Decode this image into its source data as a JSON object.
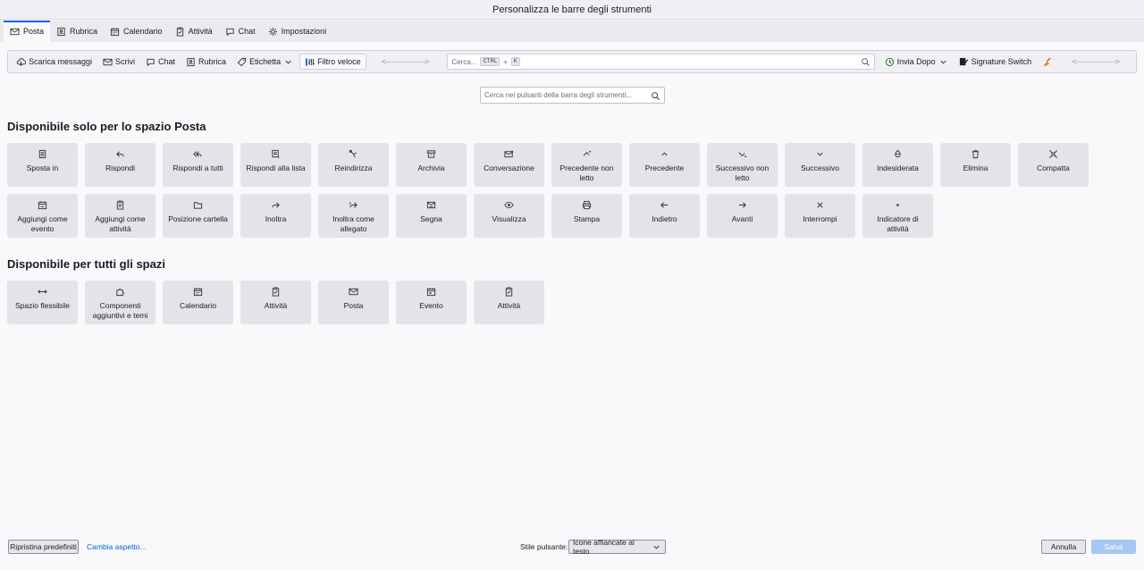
{
  "window": {
    "title": "Personalizza le barre degli strumenti"
  },
  "tabs": [
    {
      "label": "Posta",
      "icon": "mail-icon",
      "active": true
    },
    {
      "label": "Rubrica",
      "icon": "address-book-icon",
      "active": false
    },
    {
      "label": "Calendario",
      "icon": "calendar-icon",
      "active": false
    },
    {
      "label": "Attività",
      "icon": "tasks-icon",
      "active": false
    },
    {
      "label": "Chat",
      "icon": "chat-icon",
      "active": false
    },
    {
      "label": "Impostazioni",
      "icon": "gear-icon",
      "active": false
    }
  ],
  "toolbar": {
    "get_messages": "Scarica messaggi",
    "write": "Scrivi",
    "chat": "Chat",
    "address_book": "Rubrica",
    "tag": "Etichetta",
    "quick_filter": "Filtro veloce",
    "flexible_space": "<- - - - - - - - - - - - ->",
    "search_placeholder": "Cerca...",
    "search_key1": "CTRL",
    "search_plus": "+",
    "search_key2": "K",
    "send_later": "Invia Dopo",
    "signature_switch": "Signature Switch",
    "flexible_space_2": "<- - - - - - - - - - - - ->"
  },
  "palette_search": {
    "placeholder": "Cerca nei pulsanti della barra degli strumenti..."
  },
  "sections": {
    "mail_only": "Disponibile solo per lo spazio Posta",
    "all_spaces": "Disponibile per tutti gli spazi"
  },
  "mail_items": [
    {
      "label": "Sposta in",
      "icon": "move-icon"
    },
    {
      "label": "Rispondi",
      "icon": "reply-icon"
    },
    {
      "label": "Rispondi a tutti",
      "icon": "reply-all-icon"
    },
    {
      "label": "Rispondi alla lista",
      "icon": "reply-list-icon"
    },
    {
      "label": "Reindirizza",
      "icon": "redirect-icon"
    },
    {
      "label": "Archivia",
      "icon": "archive-icon"
    },
    {
      "label": "Conversazione",
      "icon": "conversation-icon"
    },
    {
      "label": "Precedente non letto",
      "icon": "previous-unread-icon"
    },
    {
      "label": "Precedente",
      "icon": "chevron-up-icon"
    },
    {
      "label": "Successivo non letto",
      "icon": "next-unread-icon"
    },
    {
      "label": "Successivo",
      "icon": "chevron-down-icon"
    },
    {
      "label": "Indesiderata",
      "icon": "junk-icon"
    },
    {
      "label": "Elimina",
      "icon": "trash-icon"
    },
    {
      "label": "Compatta",
      "icon": "compact-icon"
    },
    {
      "label": "Aggiungi come evento",
      "icon": "add-event-icon"
    },
    {
      "label": "Aggiungi come attività",
      "icon": "add-task-icon"
    },
    {
      "label": "Posizione cartella",
      "icon": "folder-icon"
    },
    {
      "label": "Inoltra",
      "icon": "forward-icon"
    },
    {
      "label": "Inoltra come allegato",
      "icon": "forward-attachment-icon"
    },
    {
      "label": "Segna",
      "icon": "mark-icon"
    },
    {
      "label": "Visualizza",
      "icon": "eye-icon"
    },
    {
      "label": "Stampa",
      "icon": "print-icon"
    },
    {
      "label": "Indietro",
      "icon": "arrow-left-icon"
    },
    {
      "label": "Avanti",
      "icon": "arrow-right-icon"
    },
    {
      "label": "Interrompi",
      "icon": "close-icon"
    },
    {
      "label": "Indicatore di attività",
      "icon": "dot-icon"
    }
  ],
  "global_items": [
    {
      "label": "Spazio flessibile",
      "icon": "flexible-space-icon"
    },
    {
      "label": "Componenti aggiuntivi e temi",
      "icon": "puzzle-icon"
    },
    {
      "label": "Calendario",
      "icon": "calendar-icon"
    },
    {
      "label": "Attività",
      "icon": "tasks-icon"
    },
    {
      "label": "Posta",
      "icon": "mail-icon"
    },
    {
      "label": "Evento",
      "icon": "event-icon"
    },
    {
      "label": "Attività",
      "icon": "task-icon"
    }
  ],
  "footer": {
    "restore_defaults": "Ripristina predefiniti",
    "change_look": "Cambia aspetto...",
    "button_style_label": "Stile pulsante:",
    "button_style_value": "Icone affiancate al testo",
    "cancel": "Annulla",
    "save": "Salva"
  }
}
